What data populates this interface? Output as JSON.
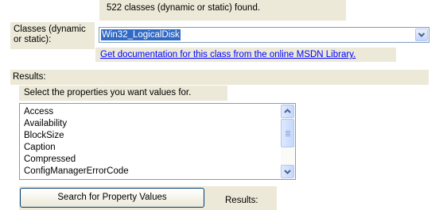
{
  "header": {
    "count_text": "522 classes (dynamic or static) found."
  },
  "classes": {
    "label": "Classes (dynamic or static):",
    "selected_value": "Win32_LogicalDisk",
    "doc_link": "Get documentation for this class from the online MSDN Library."
  },
  "results": {
    "section_label": "Results:",
    "select_prompt": "Select the properties you want values for.",
    "properties": [
      "Access",
      "Availability",
      "BlockSize",
      "Caption",
      "Compressed",
      "ConfigManagerErrorCode"
    ],
    "search_button": "Search for Property Values",
    "results_label": "Results:"
  },
  "icons": {
    "combo_arrow": "chevron-down-icon",
    "scroll_up": "chevron-up-icon",
    "scroll_down": "chevron-down-icon"
  }
}
